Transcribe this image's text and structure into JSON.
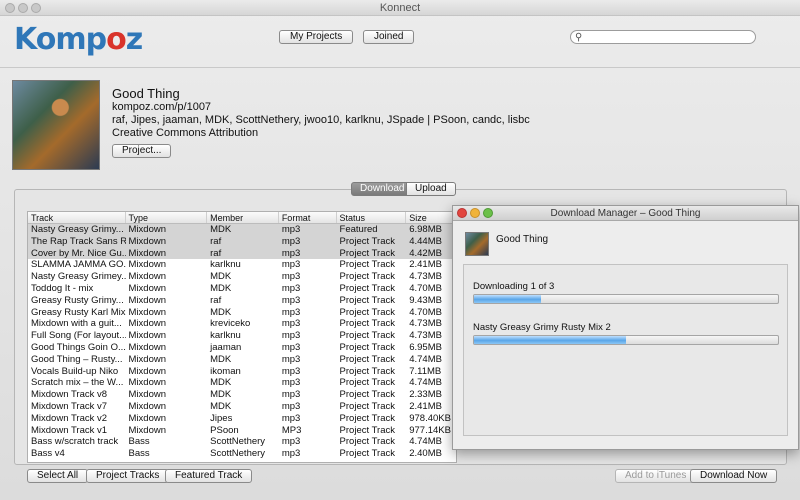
{
  "app": {
    "title": "Konnect",
    "logo_text": "Kompoz"
  },
  "header": {
    "my_projects_label": "My Projects",
    "joined_label": "Joined",
    "search_placeholder": ""
  },
  "project": {
    "title": "Good Thing",
    "url": "kompoz.com/p/1007",
    "members": "raf, Jipes, jaaman, MDK, ScottNethery, jwoo10, karlknu, JSpade | PSoon, candc, lisbc",
    "license": "Creative Commons Attribution",
    "project_button_label": "Project..."
  },
  "tabs": [
    {
      "label": "Download",
      "active": true
    },
    {
      "label": "Upload",
      "active": false
    }
  ],
  "table": {
    "columns": [
      "Track",
      "Type",
      "Member",
      "Format",
      "Status",
      "Size"
    ],
    "rows": [
      {
        "track": "Nasty Greasy Grimy...",
        "type": "Mixdown",
        "member": "MDK",
        "format": "mp3",
        "status": "Featured",
        "size": "6.98MB",
        "selected": true
      },
      {
        "track": "The Rap Track Sans Rap",
        "type": "Mixdown",
        "member": "raf",
        "format": "mp3",
        "status": "Project Track",
        "size": "4.44MB",
        "selected": true
      },
      {
        "track": "Cover by Mr. Nice Gu...",
        "type": "Mixdown",
        "member": "raf",
        "format": "mp3",
        "status": "Project Track",
        "size": "4.42MB",
        "selected": true
      },
      {
        "track": "SLAMMA JAMMA GO...",
        "type": "Mixdown",
        "member": "karlknu",
        "format": "mp3",
        "status": "Project Track",
        "size": "2.41MB",
        "selected": false
      },
      {
        "track": "Nasty Greasy Grimey...",
        "type": "Mixdown",
        "member": "MDK",
        "format": "mp3",
        "status": "Project Track",
        "size": "4.73MB",
        "selected": false
      },
      {
        "track": "Toddog It - mix",
        "type": "Mixdown",
        "member": "MDK",
        "format": "mp3",
        "status": "Project Track",
        "size": "4.70MB",
        "selected": false
      },
      {
        "track": "Greasy Rusty Grimy...",
        "type": "Mixdown",
        "member": "raf",
        "format": "mp3",
        "status": "Project Track",
        "size": "9.43MB",
        "selected": false
      },
      {
        "track": "Greasy Rusty Karl Mix",
        "type": "Mixdown",
        "member": "MDK",
        "format": "mp3",
        "status": "Project Track",
        "size": "4.70MB",
        "selected": false
      },
      {
        "track": "Mixdown with a guit...",
        "type": "Mixdown",
        "member": "kreviceko",
        "format": "mp3",
        "status": "Project Track",
        "size": "4.73MB",
        "selected": false
      },
      {
        "track": "Full Song (For layout...",
        "type": "Mixdown",
        "member": "karlknu",
        "format": "mp3",
        "status": "Project Track",
        "size": "4.73MB",
        "selected": false
      },
      {
        "track": "Good Things Goin O...",
        "type": "Mixdown",
        "member": "jaaman",
        "format": "mp3",
        "status": "Project Track",
        "size": "6.95MB",
        "selected": false
      },
      {
        "track": "Good Thing – Rusty...",
        "type": "Mixdown",
        "member": "MDK",
        "format": "mp3",
        "status": "Project Track",
        "size": "4.74MB",
        "selected": false
      },
      {
        "track": "Vocals Build-up Niko",
        "type": "Mixdown",
        "member": "ikoman",
        "format": "mp3",
        "status": "Project Track",
        "size": "7.11MB",
        "selected": false
      },
      {
        "track": "Scratch mix – the W...",
        "type": "Mixdown",
        "member": "MDK",
        "format": "mp3",
        "status": "Project Track",
        "size": "4.74MB",
        "selected": false
      },
      {
        "track": "Mixdown Track v8",
        "type": "Mixdown",
        "member": "MDK",
        "format": "mp3",
        "status": "Project Track",
        "size": "2.33MB",
        "selected": false
      },
      {
        "track": "Mixdown Track v7",
        "type": "Mixdown",
        "member": "MDK",
        "format": "mp3",
        "status": "Project Track",
        "size": "2.41MB",
        "selected": false
      },
      {
        "track": "Mixdown Track v2",
        "type": "Mixdown",
        "member": "Jipes",
        "format": "mp3",
        "status": "Project Track",
        "size": "978.40KB",
        "selected": false
      },
      {
        "track": "Mixdown Track v1",
        "type": "Mixdown",
        "member": "PSoon",
        "format": "MP3",
        "status": "Project Track",
        "size": "977.14KB",
        "selected": false
      },
      {
        "track": "Bass w/scratch track",
        "type": "Bass",
        "member": "ScottNethery",
        "format": "mp3",
        "status": "Project Track",
        "size": "4.74MB",
        "selected": false
      },
      {
        "track": "Bass v4",
        "type": "Bass",
        "member": "ScottNethery",
        "format": "mp3",
        "status": "Project Track",
        "size": "2.40MB",
        "selected": false
      }
    ]
  },
  "bottom_bar": {
    "select_all": "Select All",
    "project_tracks": "Project Tracks",
    "featured_track": "Featured Track",
    "add_to_itunes": "Add to iTunes",
    "download_now": "Download Now"
  },
  "download_manager": {
    "title": "Download Manager – Good Thing",
    "project_name": "Good Thing",
    "overall_label": "Downloading 1 of 3",
    "overall_progress": 0.22,
    "file_label": "Nasty Greasy Grimy Rusty Mix 2",
    "file_progress": 0.5
  },
  "colors": {
    "logo_blue": "#2f77b8",
    "logo_red": "#d9342b",
    "selected_row": "#d4d4d4",
    "progress_blue": "#5aa6e8"
  }
}
